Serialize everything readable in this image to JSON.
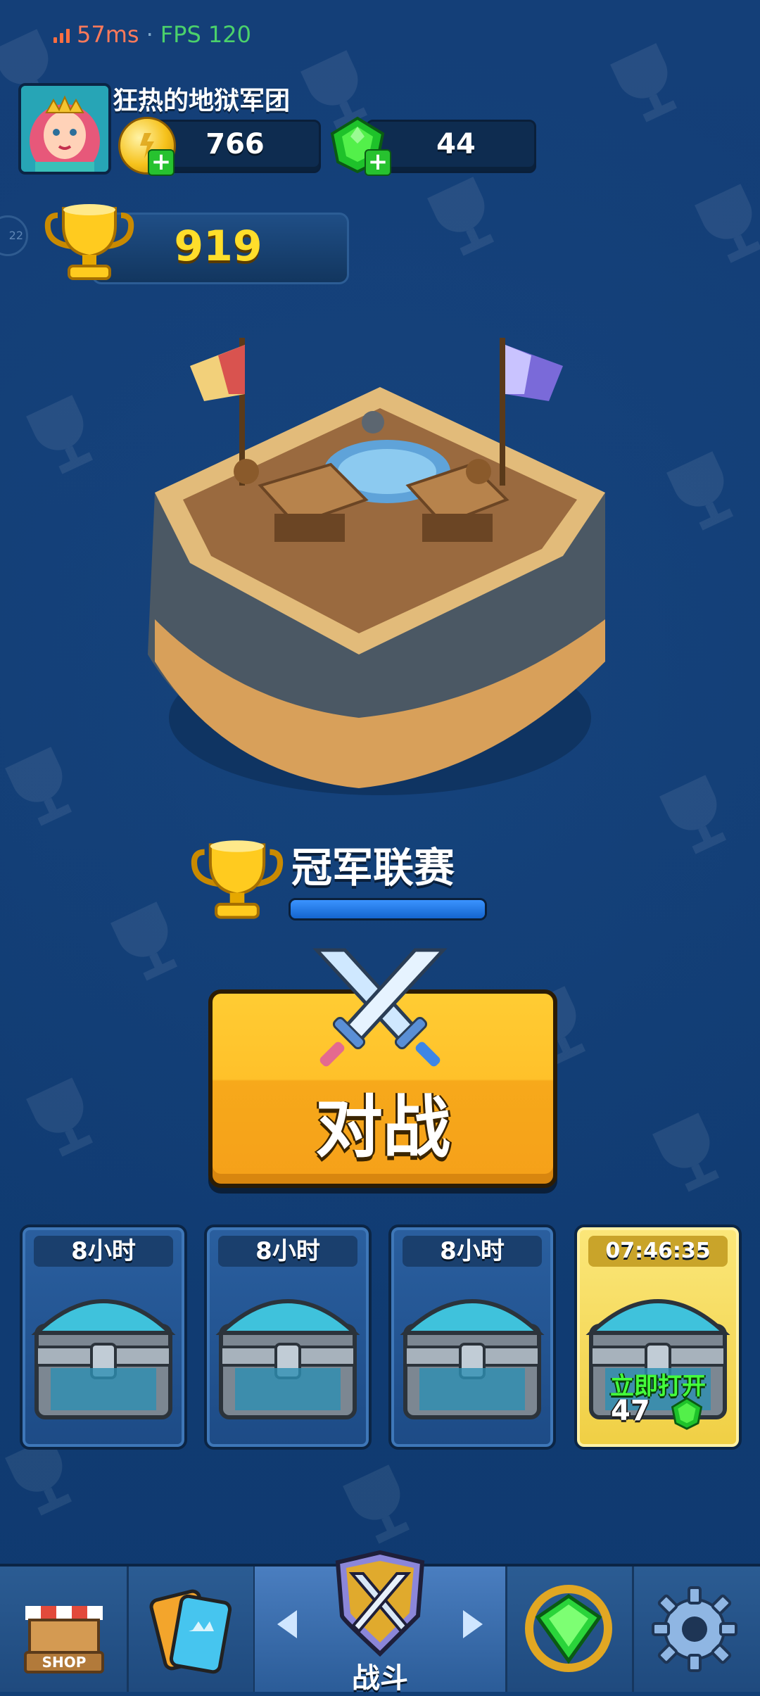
{
  "status": {
    "ping": "57ms",
    "separator": "·",
    "fps": "FPS 120"
  },
  "player": {
    "name": "狂热的地狱军团",
    "coins": "766",
    "gems": "44",
    "trophies": "919",
    "side_badge": "22"
  },
  "league": {
    "name": "冠军联赛",
    "progress": 1.0
  },
  "battle": {
    "label": "对战"
  },
  "chests": [
    {
      "timer": "8小时"
    },
    {
      "timer": "8小时"
    },
    {
      "timer": "8小时"
    },
    {
      "timer": "07:46:35",
      "action": "立即打开",
      "cost": "47"
    }
  ],
  "nav": {
    "items": [
      {
        "name": "shop",
        "icon": "shop-icon",
        "label": "SHOP"
      },
      {
        "name": "cards",
        "icon": "cards-icon"
      },
      {
        "name": "battle",
        "icon": "battle-shield-icon",
        "label": "战斗"
      },
      {
        "name": "gems",
        "icon": "gem-icon"
      },
      {
        "name": "settings",
        "icon": "gear-icon"
      }
    ]
  },
  "colors": {
    "background": "#123f76",
    "trophy_text": "#ffde2b",
    "battle_button": "#ffc12a",
    "green": "#27c22f"
  }
}
